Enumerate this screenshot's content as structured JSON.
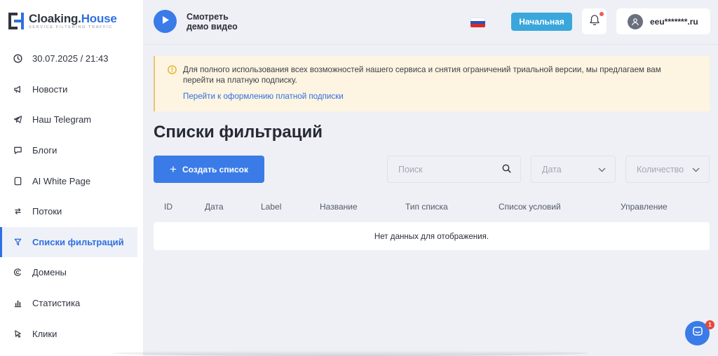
{
  "logo": {
    "name_part1": "Cloaking.",
    "name_part2": "House",
    "tagline": "SERVICE FILTERING TRAFFIC"
  },
  "sidebar": {
    "items": [
      {
        "label": "30.07.2025 / 21:43",
        "icon": "clock-icon",
        "active": false
      },
      {
        "label": "Новости",
        "icon": "megaphone-icon",
        "active": false
      },
      {
        "label": "Наш Telegram",
        "icon": "telegram-icon",
        "active": false
      },
      {
        "label": "Блоги",
        "icon": "chat-bubble-icon",
        "active": false
      },
      {
        "label": "AI White Page",
        "icon": "document-icon",
        "active": false
      },
      {
        "label": "Потоки",
        "icon": "flows-icon",
        "active": false
      },
      {
        "label": "Списки фильтраций",
        "icon": "filter-icon",
        "active": true
      },
      {
        "label": "Домены",
        "icon": "domain-icon",
        "active": false
      },
      {
        "label": "Статистика",
        "icon": "stats-icon",
        "active": false
      },
      {
        "label": "Клики",
        "icon": "cursor-icon",
        "active": false
      }
    ]
  },
  "header": {
    "demo_line1": "Смотреть",
    "demo_line2": "демо видео",
    "home_button": "Начальная",
    "user_email": "eeu*******.ru",
    "language_flag": "russia-flag-icon"
  },
  "alert": {
    "text": "Для полного использования всех возможностей нашего сервиса и снятия ограничений триальной версии, мы предлагаем вам перейти на платную подписку.",
    "link": "Перейти к оформлению платной подписки"
  },
  "page": {
    "title": "Списки фильтраций",
    "create_button": "Создать список",
    "search_placeholder": "Поиск",
    "date_select": "Дата",
    "count_select": "Количество"
  },
  "table": {
    "columns": [
      "ID",
      "Дата",
      "Label",
      "Название",
      "Тип списка",
      "Список условий",
      "Управление"
    ],
    "empty_text": "Нет данных для отображения."
  },
  "chat": {
    "badge_count": "1"
  },
  "colors": {
    "accent": "#3a7be8",
    "home_button": "#3aa7dc",
    "alert_bg": "#fdf4e1",
    "badge": "#e5483c"
  }
}
